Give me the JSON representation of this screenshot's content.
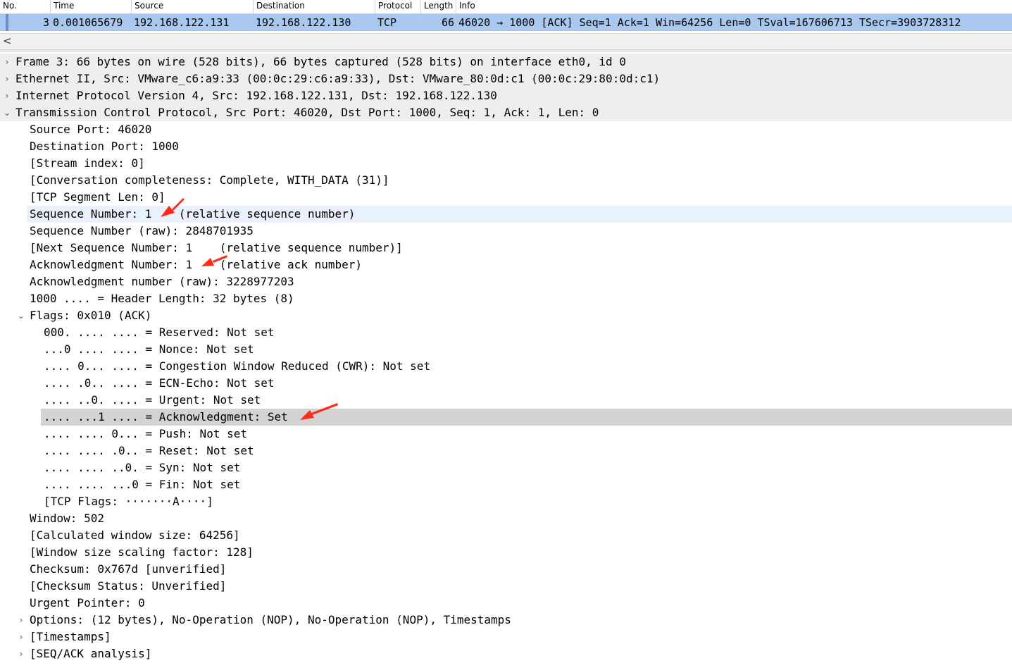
{
  "packet_list": {
    "columns": [
      "No.",
      "Time",
      "Source",
      "Destination",
      "Protocol",
      "Length",
      "Info"
    ],
    "selected_packet": {
      "no": "3",
      "time": "0.001065679",
      "source": "192.168.122.131",
      "destination": "192.168.122.130",
      "protocol": "TCP",
      "length": "66",
      "info": "46020 → 1000 [ACK] Seq=1 Ack=1 Win=64256 Len=0 TSval=167606713 TSecr=3903728312"
    }
  },
  "scrollbar": {
    "left_arrow": "<"
  },
  "details": [
    {
      "text": "Frame 3: 66 bytes on wire (528 bits), 66 bytes captured (528 bits) on interface eth0, id 0",
      "level": 0,
      "toggle": "›",
      "style": "shade"
    },
    {
      "text": "Ethernet II, Src: VMware_c6:a9:33 (00:0c:29:c6:a9:33), Dst: VMware_80:0d:c1 (00:0c:29:80:0d:c1)",
      "level": 0,
      "toggle": "›",
      "style": "shade"
    },
    {
      "text": "Internet Protocol Version 4, Src: 192.168.122.131, Dst: 192.168.122.130",
      "level": 0,
      "toggle": "›",
      "style": "shade"
    },
    {
      "text": "Transmission Control Protocol, Src Port: 46020, Dst Port: 1000, Seq: 1, Ack: 1, Len: 0",
      "level": 0,
      "toggle": "⌄",
      "style": "shade"
    },
    {
      "text": "Source Port: 46020",
      "level": 1,
      "toggle": "",
      "style": ""
    },
    {
      "text": "Destination Port: 1000",
      "level": 1,
      "toggle": "",
      "style": ""
    },
    {
      "text": "[Stream index: 0]",
      "level": 1,
      "toggle": "",
      "style": ""
    },
    {
      "text": "[Conversation completeness: Complete, WITH_DATA (31)]",
      "level": 1,
      "toggle": "",
      "style": ""
    },
    {
      "text": "[TCP Segment Len: 0]",
      "level": 1,
      "toggle": "",
      "style": ""
    },
    {
      "text": "Sequence Number: 1    (relative sequence number)",
      "level": 1,
      "toggle": "",
      "style": "sel"
    },
    {
      "text": "Sequence Number (raw): 2848701935",
      "level": 1,
      "toggle": "",
      "style": ""
    },
    {
      "text": "[Next Sequence Number: 1    (relative sequence number)]",
      "level": 1,
      "toggle": "",
      "style": ""
    },
    {
      "text": "Acknowledgment Number: 1    (relative ack number)",
      "level": 1,
      "toggle": "",
      "style": ""
    },
    {
      "text": "Acknowledgment number (raw): 3228977203",
      "level": 1,
      "toggle": "",
      "style": ""
    },
    {
      "text": "1000 .... = Header Length: 32 bytes (8)",
      "level": 1,
      "toggle": "",
      "style": ""
    },
    {
      "text": "Flags: 0x010 (ACK)",
      "level": 1,
      "toggle": "⌄",
      "style": ""
    },
    {
      "text": "000. .... .... = Reserved: Not set",
      "level": 2,
      "toggle": "",
      "style": ""
    },
    {
      "text": "...0 .... .... = Nonce: Not set",
      "level": 2,
      "toggle": "",
      "style": ""
    },
    {
      "text": ".... 0... .... = Congestion Window Reduced (CWR): Not set",
      "level": 2,
      "toggle": "",
      "style": ""
    },
    {
      "text": ".... .0.. .... = ECN-Echo: Not set",
      "level": 2,
      "toggle": "",
      "style": ""
    },
    {
      "text": ".... ..0. .... = Urgent: Not set",
      "level": 2,
      "toggle": "",
      "style": ""
    },
    {
      "text": ".... ...1 .... = Acknowledgment: Set",
      "level": 2,
      "toggle": "",
      "style": "hl"
    },
    {
      "text": ".... .... 0... = Push: Not set",
      "level": 2,
      "toggle": "",
      "style": ""
    },
    {
      "text": ".... .... .0.. = Reset: Not set",
      "level": 2,
      "toggle": "",
      "style": ""
    },
    {
      "text": ".... .... ..0. = Syn: Not set",
      "level": 2,
      "toggle": "",
      "style": ""
    },
    {
      "text": ".... .... ...0 = Fin: Not set",
      "level": 2,
      "toggle": "",
      "style": ""
    },
    {
      "text": "[TCP Flags: ·······A····]",
      "level": 2,
      "toggle": "",
      "style": ""
    },
    {
      "text": "Window: 502",
      "level": 1,
      "toggle": "",
      "style": ""
    },
    {
      "text": "[Calculated window size: 64256]",
      "level": 1,
      "toggle": "",
      "style": ""
    },
    {
      "text": "[Window size scaling factor: 128]",
      "level": 1,
      "toggle": "",
      "style": ""
    },
    {
      "text": "Checksum: 0x767d [unverified]",
      "level": 1,
      "toggle": "",
      "style": ""
    },
    {
      "text": "[Checksum Status: Unverified]",
      "level": 1,
      "toggle": "",
      "style": ""
    },
    {
      "text": "Urgent Pointer: 0",
      "level": 1,
      "toggle": "",
      "style": ""
    },
    {
      "text": "Options: (12 bytes), No-Operation (NOP), No-Operation (NOP), Timestamps",
      "level": 1,
      "toggle": "›",
      "style": ""
    },
    {
      "text": "[Timestamps]",
      "level": 1,
      "toggle": "›",
      "style": ""
    },
    {
      "text": "[SEQ/ACK analysis]",
      "level": 1,
      "toggle": "›",
      "style": ""
    }
  ],
  "colors": {
    "selected_packet_row": "#a8c8f0",
    "selected_field_row": "#e9f1fc",
    "highlighted_field_row": "#d3d3d3",
    "annotation_arrow": "#ff2a1a"
  }
}
